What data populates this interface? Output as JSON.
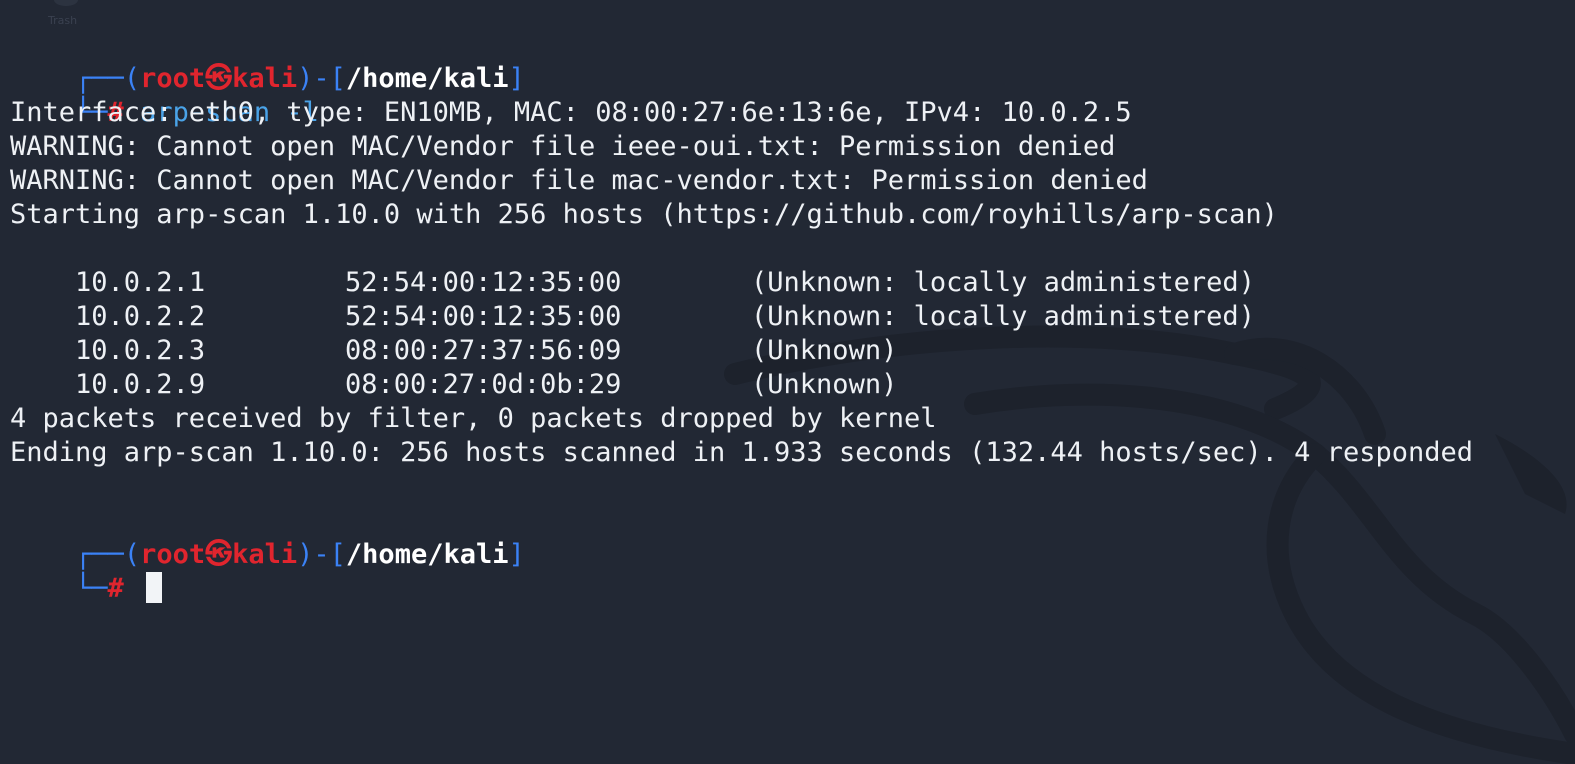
{
  "desktop": {
    "trash_label": "Trash"
  },
  "prompt": {
    "open_paren": "(",
    "user": "root",
    "at_symbol": "㉿",
    "host": "kali",
    "separator": ")-[",
    "cwd": "/home/kali",
    "close_bracket": "]",
    "hash": "#"
  },
  "command": {
    "text": "arp-scan -l"
  },
  "output": {
    "lines_before": [
      "Interface: eth0, type: EN10MB, MAC: 08:00:27:6e:13:6e, IPv4: 10.0.2.5",
      "WARNING: Cannot open MAC/Vendor file ieee-oui.txt: Permission denied",
      "WARNING: Cannot open MAC/Vendor file mac-vendor.txt: Permission denied",
      "Starting arp-scan 1.10.0 with 256 hosts (https://github.com/royhills/arp-scan)"
    ],
    "hosts": [
      {
        "ip": "10.0.2.1",
        "mac": "52:54:00:12:35:00",
        "vendor": "(Unknown: locally administered)"
      },
      {
        "ip": "10.0.2.2",
        "mac": "52:54:00:12:35:00",
        "vendor": "(Unknown: locally administered)"
      },
      {
        "ip": "10.0.2.3",
        "mac": "08:00:27:37:56:09",
        "vendor": "(Unknown)"
      },
      {
        "ip": "10.0.2.9",
        "mac": "08:00:27:0d:0b:29",
        "vendor": "(Unknown)"
      }
    ],
    "lines_after": [
      "4 packets received by filter, 0 packets dropped by kernel",
      "Ending arp-scan 1.10.0: 256 hosts scanned in 1.933 seconds (132.44 hosts/sec). 4 responded"
    ]
  },
  "colors": {
    "background": "#222834",
    "prompt_frame": "#3b82f6",
    "prompt_user": "#e0252e",
    "command": "#4aa3e8",
    "text": "#eef1f5"
  }
}
